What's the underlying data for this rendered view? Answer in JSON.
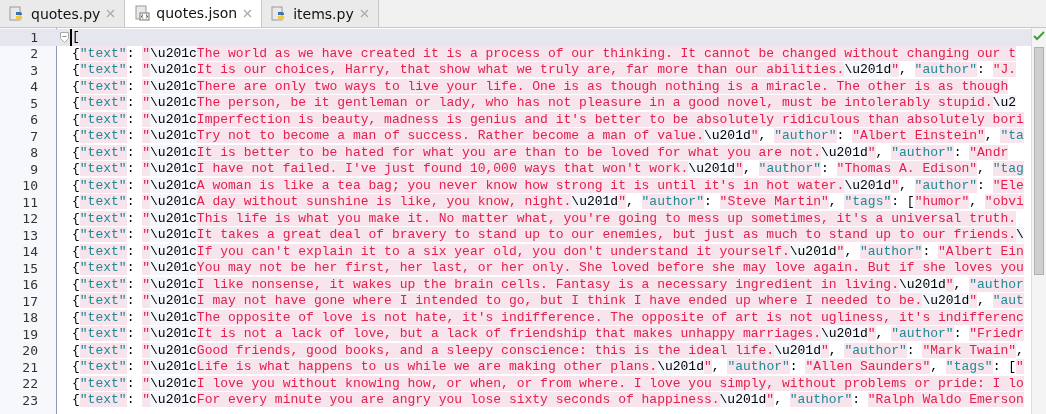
{
  "tabs": [
    {
      "label": "quotes.py",
      "kind": "python",
      "selected": false
    },
    {
      "label": "quotes.json",
      "kind": "json",
      "selected": true
    },
    {
      "label": "items.py",
      "kind": "python",
      "selected": false
    }
  ],
  "editor": {
    "lines": [
      {
        "number": "1",
        "current": true,
        "segments": [
          {
            "kind": "punct",
            "text": "["
          }
        ]
      },
      {
        "number": "2",
        "current": false,
        "segments": [
          {
            "kind": "punct",
            "text": "{"
          },
          {
            "kind": "key",
            "text": "\"text\""
          },
          {
            "kind": "punct",
            "text": ": "
          },
          {
            "kind": "string",
            "text": "\""
          },
          {
            "kind": "escape",
            "text": "\\u201c"
          },
          {
            "kind": "string",
            "text": "The world as we have created it is a process of our thinking. It cannot be changed without changing our t"
          }
        ]
      },
      {
        "number": "3",
        "current": false,
        "segments": [
          {
            "kind": "punct",
            "text": "{"
          },
          {
            "kind": "key",
            "text": "\"text\""
          },
          {
            "kind": "punct",
            "text": ": "
          },
          {
            "kind": "string",
            "text": "\""
          },
          {
            "kind": "escape",
            "text": "\\u201c"
          },
          {
            "kind": "string",
            "text": "It is our choices, Harry, that show what we truly are, far more than our abilities."
          },
          {
            "kind": "escape",
            "text": "\\u201d"
          },
          {
            "kind": "string",
            "text": "\""
          },
          {
            "kind": "punct",
            "text": ", "
          },
          {
            "kind": "key",
            "text": "\"author\""
          },
          {
            "kind": "punct",
            "text": ": "
          },
          {
            "kind": "string",
            "text": "\"J."
          }
        ]
      },
      {
        "number": "4",
        "current": false,
        "segments": [
          {
            "kind": "punct",
            "text": "{"
          },
          {
            "kind": "key",
            "text": "\"text\""
          },
          {
            "kind": "punct",
            "text": ": "
          },
          {
            "kind": "string",
            "text": "\""
          },
          {
            "kind": "escape",
            "text": "\\u201c"
          },
          {
            "kind": "string",
            "text": "There are only two ways to live your life. One is as though nothing is a miracle. The other is as though"
          }
        ]
      },
      {
        "number": "5",
        "current": false,
        "segments": [
          {
            "kind": "punct",
            "text": "{"
          },
          {
            "kind": "key",
            "text": "\"text\""
          },
          {
            "kind": "punct",
            "text": ": "
          },
          {
            "kind": "string",
            "text": "\""
          },
          {
            "kind": "escape",
            "text": "\\u201c"
          },
          {
            "kind": "string",
            "text": "The person, be it gentleman or lady, who has not pleasure in a good novel, must be intolerably stupid."
          },
          {
            "kind": "escape",
            "text": "\\u2"
          }
        ]
      },
      {
        "number": "6",
        "current": false,
        "segments": [
          {
            "kind": "punct",
            "text": "{"
          },
          {
            "kind": "key",
            "text": "\"text\""
          },
          {
            "kind": "punct",
            "text": ": "
          },
          {
            "kind": "string",
            "text": "\""
          },
          {
            "kind": "escape",
            "text": "\\u201c"
          },
          {
            "kind": "string",
            "text": "Imperfection is beauty, madness is genius and it's better to be absolutely ridiculous than absolutely bori"
          }
        ]
      },
      {
        "number": "7",
        "current": false,
        "segments": [
          {
            "kind": "punct",
            "text": "{"
          },
          {
            "kind": "key",
            "text": "\"text\""
          },
          {
            "kind": "punct",
            "text": ": "
          },
          {
            "kind": "string",
            "text": "\""
          },
          {
            "kind": "escape",
            "text": "\\u201c"
          },
          {
            "kind": "string",
            "text": "Try not to become a man of success. Rather become a man of value."
          },
          {
            "kind": "escape",
            "text": "\\u201d"
          },
          {
            "kind": "string",
            "text": "\""
          },
          {
            "kind": "punct",
            "text": ", "
          },
          {
            "kind": "key",
            "text": "\"author\""
          },
          {
            "kind": "punct",
            "text": ": "
          },
          {
            "kind": "string",
            "text": "\"Albert Einstein\""
          },
          {
            "kind": "punct",
            "text": ", "
          },
          {
            "kind": "key",
            "text": "\"ta"
          }
        ]
      },
      {
        "number": "8",
        "current": false,
        "segments": [
          {
            "kind": "punct",
            "text": "{"
          },
          {
            "kind": "key",
            "text": "\"text\""
          },
          {
            "kind": "punct",
            "text": ": "
          },
          {
            "kind": "string",
            "text": "\""
          },
          {
            "kind": "escape",
            "text": "\\u201c"
          },
          {
            "kind": "string",
            "text": "It is better to be hated for what you are than to be loved for what you are not."
          },
          {
            "kind": "escape",
            "text": "\\u201d"
          },
          {
            "kind": "string",
            "text": "\""
          },
          {
            "kind": "punct",
            "text": ", "
          },
          {
            "kind": "key",
            "text": "\"author\""
          },
          {
            "kind": "punct",
            "text": ": "
          },
          {
            "kind": "string",
            "text": "\"Andr"
          }
        ]
      },
      {
        "number": "9",
        "current": false,
        "segments": [
          {
            "kind": "punct",
            "text": "{"
          },
          {
            "kind": "key",
            "text": "\"text\""
          },
          {
            "kind": "punct",
            "text": ": "
          },
          {
            "kind": "string",
            "text": "\""
          },
          {
            "kind": "escape",
            "text": "\\u201c"
          },
          {
            "kind": "string",
            "text": "I have not failed. I've just found 10,000 ways that won't work."
          },
          {
            "kind": "escape",
            "text": "\\u201d"
          },
          {
            "kind": "string",
            "text": "\""
          },
          {
            "kind": "punct",
            "text": ", "
          },
          {
            "kind": "key",
            "text": "\"author\""
          },
          {
            "kind": "punct",
            "text": ": "
          },
          {
            "kind": "string",
            "text": "\"Thomas A. Edison\""
          },
          {
            "kind": "punct",
            "text": ", "
          },
          {
            "kind": "key",
            "text": "\"tag"
          }
        ]
      },
      {
        "number": "10",
        "current": false,
        "segments": [
          {
            "kind": "punct",
            "text": "{"
          },
          {
            "kind": "key",
            "text": "\"text\""
          },
          {
            "kind": "punct",
            "text": ": "
          },
          {
            "kind": "string",
            "text": "\""
          },
          {
            "kind": "escape",
            "text": "\\u201c"
          },
          {
            "kind": "string",
            "text": "A woman is like a tea bag; you never know how strong it is until it's in hot water."
          },
          {
            "kind": "escape",
            "text": "\\u201d"
          },
          {
            "kind": "string",
            "text": "\""
          },
          {
            "kind": "punct",
            "text": ", "
          },
          {
            "kind": "key",
            "text": "\"author\""
          },
          {
            "kind": "punct",
            "text": ": "
          },
          {
            "kind": "string",
            "text": "\"Ele"
          }
        ]
      },
      {
        "number": "11",
        "current": false,
        "segments": [
          {
            "kind": "punct",
            "text": "{"
          },
          {
            "kind": "key",
            "text": "\"text\""
          },
          {
            "kind": "punct",
            "text": ": "
          },
          {
            "kind": "string",
            "text": "\""
          },
          {
            "kind": "escape",
            "text": "\\u201c"
          },
          {
            "kind": "string",
            "text": "A day without sunshine is like, you know, night."
          },
          {
            "kind": "escape",
            "text": "\\u201d"
          },
          {
            "kind": "string",
            "text": "\""
          },
          {
            "kind": "punct",
            "text": ", "
          },
          {
            "kind": "key",
            "text": "\"author\""
          },
          {
            "kind": "punct",
            "text": ": "
          },
          {
            "kind": "string",
            "text": "\"Steve Martin\""
          },
          {
            "kind": "punct",
            "text": ", "
          },
          {
            "kind": "key",
            "text": "\"tags\""
          },
          {
            "kind": "punct",
            "text": ": ["
          },
          {
            "kind": "string",
            "text": "\"humor\""
          },
          {
            "kind": "punct",
            "text": ", "
          },
          {
            "kind": "string",
            "text": "\"obvi"
          }
        ]
      },
      {
        "number": "12",
        "current": false,
        "segments": [
          {
            "kind": "punct",
            "text": "{"
          },
          {
            "kind": "key",
            "text": "\"text\""
          },
          {
            "kind": "punct",
            "text": ": "
          },
          {
            "kind": "string",
            "text": "\""
          },
          {
            "kind": "escape",
            "text": "\\u201c"
          },
          {
            "kind": "string",
            "text": "This life is what you make it. No matter what, you're going to mess up sometimes, it's a universal truth."
          }
        ]
      },
      {
        "number": "13",
        "current": false,
        "segments": [
          {
            "kind": "punct",
            "text": "{"
          },
          {
            "kind": "key",
            "text": "\"text\""
          },
          {
            "kind": "punct",
            "text": ": "
          },
          {
            "kind": "string",
            "text": "\""
          },
          {
            "kind": "escape",
            "text": "\\u201c"
          },
          {
            "kind": "string",
            "text": "It takes a great deal of bravery to stand up to our enemies, but just as much to stand up to our friends."
          },
          {
            "kind": "escape",
            "text": "\\"
          }
        ]
      },
      {
        "number": "14",
        "current": false,
        "segments": [
          {
            "kind": "punct",
            "text": "{"
          },
          {
            "kind": "key",
            "text": "\"text\""
          },
          {
            "kind": "punct",
            "text": ": "
          },
          {
            "kind": "string",
            "text": "\""
          },
          {
            "kind": "escape",
            "text": "\\u201c"
          },
          {
            "kind": "string",
            "text": "If you can't explain it to a six year old, you don't understand it yourself."
          },
          {
            "kind": "escape",
            "text": "\\u201d"
          },
          {
            "kind": "string",
            "text": "\""
          },
          {
            "kind": "punct",
            "text": ", "
          },
          {
            "kind": "key",
            "text": "\"author\""
          },
          {
            "kind": "punct",
            "text": ": "
          },
          {
            "kind": "string",
            "text": "\"Albert Ein"
          }
        ]
      },
      {
        "number": "15",
        "current": false,
        "segments": [
          {
            "kind": "punct",
            "text": "{"
          },
          {
            "kind": "key",
            "text": "\"text\""
          },
          {
            "kind": "punct",
            "text": ": "
          },
          {
            "kind": "string",
            "text": "\""
          },
          {
            "kind": "escape",
            "text": "\\u201c"
          },
          {
            "kind": "string",
            "text": "You may not be her first, her last, or her only. She loved before she may love again. But if she loves you"
          }
        ]
      },
      {
        "number": "16",
        "current": false,
        "segments": [
          {
            "kind": "punct",
            "text": "{"
          },
          {
            "kind": "key",
            "text": "\"text\""
          },
          {
            "kind": "punct",
            "text": ": "
          },
          {
            "kind": "string",
            "text": "\""
          },
          {
            "kind": "escape",
            "text": "\\u201c"
          },
          {
            "kind": "string",
            "text": "I like nonsense, it wakes up the brain cells. Fantasy is a necessary ingredient in living."
          },
          {
            "kind": "escape",
            "text": "\\u201d"
          },
          {
            "kind": "string",
            "text": "\""
          },
          {
            "kind": "punct",
            "text": ", "
          },
          {
            "kind": "key",
            "text": "\"author"
          }
        ]
      },
      {
        "number": "17",
        "current": false,
        "segments": [
          {
            "kind": "punct",
            "text": "{"
          },
          {
            "kind": "key",
            "text": "\"text\""
          },
          {
            "kind": "punct",
            "text": ": "
          },
          {
            "kind": "string",
            "text": "\""
          },
          {
            "kind": "escape",
            "text": "\\u201c"
          },
          {
            "kind": "string",
            "text": "I may not have gone where I intended to go, but I think I have ended up where I needed to be."
          },
          {
            "kind": "escape",
            "text": "\\u201d"
          },
          {
            "kind": "string",
            "text": "\""
          },
          {
            "kind": "punct",
            "text": ", "
          },
          {
            "kind": "key",
            "text": "\"aut"
          }
        ]
      },
      {
        "number": "18",
        "current": false,
        "segments": [
          {
            "kind": "punct",
            "text": "{"
          },
          {
            "kind": "key",
            "text": "\"text\""
          },
          {
            "kind": "punct",
            "text": ": "
          },
          {
            "kind": "string",
            "text": "\""
          },
          {
            "kind": "escape",
            "text": "\\u201c"
          },
          {
            "kind": "string",
            "text": "The opposite of love is not hate, it's indifference. The opposite of art is not ugliness, it's indifferenc"
          }
        ]
      },
      {
        "number": "19",
        "current": false,
        "segments": [
          {
            "kind": "punct",
            "text": "{"
          },
          {
            "kind": "key",
            "text": "\"text\""
          },
          {
            "kind": "punct",
            "text": ": "
          },
          {
            "kind": "string",
            "text": "\""
          },
          {
            "kind": "escape",
            "text": "\\u201c"
          },
          {
            "kind": "string",
            "text": "It is not a lack of love, but a lack of friendship that makes unhappy marriages."
          },
          {
            "kind": "escape",
            "text": "\\u201d"
          },
          {
            "kind": "string",
            "text": "\""
          },
          {
            "kind": "punct",
            "text": ", "
          },
          {
            "kind": "key",
            "text": "\"author\""
          },
          {
            "kind": "punct",
            "text": ": "
          },
          {
            "kind": "string",
            "text": "\"Friedr"
          }
        ]
      },
      {
        "number": "20",
        "current": false,
        "segments": [
          {
            "kind": "punct",
            "text": "{"
          },
          {
            "kind": "key",
            "text": "\"text\""
          },
          {
            "kind": "punct",
            "text": ": "
          },
          {
            "kind": "string",
            "text": "\""
          },
          {
            "kind": "escape",
            "text": "\\u201c"
          },
          {
            "kind": "string",
            "text": "Good friends, good books, and a sleepy conscience: this is the ideal life."
          },
          {
            "kind": "escape",
            "text": "\\u201d"
          },
          {
            "kind": "string",
            "text": "\""
          },
          {
            "kind": "punct",
            "text": ", "
          },
          {
            "kind": "key",
            "text": "\"author\""
          },
          {
            "kind": "punct",
            "text": ": "
          },
          {
            "kind": "string",
            "text": "\"Mark Twain\""
          },
          {
            "kind": "punct",
            "text": ","
          }
        ]
      },
      {
        "number": "21",
        "current": false,
        "segments": [
          {
            "kind": "punct",
            "text": "{"
          },
          {
            "kind": "key",
            "text": "\"text\""
          },
          {
            "kind": "punct",
            "text": ": "
          },
          {
            "kind": "string",
            "text": "\""
          },
          {
            "kind": "escape",
            "text": "\\u201c"
          },
          {
            "kind": "string",
            "text": "Life is what happens to us while we are making other plans."
          },
          {
            "kind": "escape",
            "text": "\\u201d"
          },
          {
            "kind": "string",
            "text": "\""
          },
          {
            "kind": "punct",
            "text": ", "
          },
          {
            "kind": "key",
            "text": "\"author\""
          },
          {
            "kind": "punct",
            "text": ": "
          },
          {
            "kind": "string",
            "text": "\"Allen Saunders\""
          },
          {
            "kind": "punct",
            "text": ", "
          },
          {
            "kind": "key",
            "text": "\"tags\""
          },
          {
            "kind": "punct",
            "text": ": ["
          },
          {
            "kind": "string",
            "text": "\""
          }
        ]
      },
      {
        "number": "22",
        "current": false,
        "segments": [
          {
            "kind": "punct",
            "text": "{"
          },
          {
            "kind": "key",
            "text": "\"text\""
          },
          {
            "kind": "punct",
            "text": ": "
          },
          {
            "kind": "string",
            "text": "\""
          },
          {
            "kind": "escape",
            "text": "\\u201c"
          },
          {
            "kind": "string",
            "text": "I love you without knowing how, or when, or from where. I love you simply, without problems or pride: I lo"
          }
        ]
      },
      {
        "number": "23",
        "current": false,
        "segments": [
          {
            "kind": "punct",
            "text": "{"
          },
          {
            "kind": "key",
            "text": "\"text\""
          },
          {
            "kind": "punct",
            "text": ": "
          },
          {
            "kind": "string",
            "text": "\""
          },
          {
            "kind": "escape",
            "text": "\\u201c"
          },
          {
            "kind": "string",
            "text": "For every minute you are angry you lose sixty seconds of happiness."
          },
          {
            "kind": "escape",
            "text": "\\u201d"
          },
          {
            "kind": "string",
            "text": "\""
          },
          {
            "kind": "punct",
            "text": ", "
          },
          {
            "kind": "key",
            "text": "\"author\""
          },
          {
            "kind": "punct",
            "text": ": "
          },
          {
            "kind": "string",
            "text": "\"Ralph Waldo Emerson"
          }
        ]
      }
    ]
  }
}
